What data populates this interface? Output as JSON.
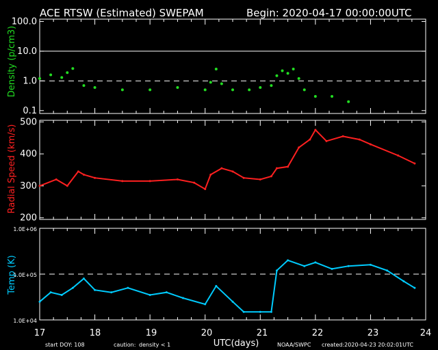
{
  "header": {
    "title": "ACE RTSW (Estimated) SWEPAM",
    "begin": "Begin: 2020-04-17 00:00:00UTC"
  },
  "footer": {
    "start_doy": "start DOY: 108",
    "caution_label": "caution:",
    "caution_value": "density < 1",
    "source": "NOAA/SWPC",
    "created": "created:2020-04-23 20:02:01UTC"
  },
  "colors": {
    "density": "#22dd22",
    "speed": "#ff2020",
    "temp": "#00ccff",
    "caution": "#ffff00",
    "axes": "#ffffff"
  },
  "chart_data": [
    {
      "type": "scatter",
      "panel": "density",
      "ylabel": "Density (p/cm3)",
      "yscale": "log",
      "ylim": [
        0.08,
        120
      ],
      "xlim": [
        17,
        24
      ],
      "yticks": [
        "0.1",
        "1.0",
        "10.0",
        "100.0"
      ],
      "reference_line": 10,
      "dashed_line": 1,
      "x": [
        17.0,
        17.2,
        17.4,
        17.5,
        17.6,
        17.8,
        18.0,
        18.5,
        19.0,
        19.5,
        20.0,
        20.1,
        20.2,
        20.3,
        20.5,
        20.8,
        21.0,
        21.2,
        21.3,
        21.4,
        21.5,
        21.6,
        21.7,
        21.8,
        22.0,
        22.3,
        22.6
      ],
      "y": [
        1.2,
        1.6,
        1.3,
        1.9,
        2.6,
        0.7,
        0.6,
        0.5,
        0.5,
        0.6,
        0.5,
        0.9,
        2.5,
        0.8,
        0.5,
        0.5,
        0.6,
        0.7,
        1.5,
        2.2,
        1.8,
        2.5,
        1.2,
        0.5,
        0.3,
        0.3,
        0.2
      ]
    },
    {
      "type": "line",
      "panel": "speed",
      "ylabel": "Radial Speed (km/s)",
      "ylim": [
        195,
        505
      ],
      "xlim": [
        17,
        24
      ],
      "yticks": [
        200,
        300,
        400,
        500
      ],
      "x": [
        17.0,
        17.3,
        17.5,
        17.7,
        17.8,
        18.0,
        18.5,
        19.0,
        19.5,
        19.8,
        20.0,
        20.1,
        20.3,
        20.5,
        20.7,
        21.0,
        21.2,
        21.3,
        21.5,
        21.7,
        21.9,
        22.0,
        22.2,
        22.5,
        22.8,
        23.0,
        23.5,
        23.8
      ],
      "y": [
        300,
        320,
        300,
        345,
        335,
        325,
        315,
        315,
        320,
        310,
        290,
        335,
        355,
        345,
        325,
        320,
        330,
        355,
        360,
        420,
        445,
        475,
        440,
        455,
        445,
        430,
        395,
        370
      ]
    },
    {
      "type": "line",
      "panel": "temp",
      "ylabel": "Temp (K)",
      "yscale": "log",
      "ylim": [
        10000,
        1000000
      ],
      "xlim": [
        17,
        24
      ],
      "yticks": [
        "1.0E+04",
        "1.0E+05",
        "1.0E+06"
      ],
      "dashed_line": 100000,
      "xlabel": "UTC(days)",
      "xticks": [
        "17",
        "18",
        "19",
        "20",
        "21",
        "22",
        "23",
        "24"
      ],
      "x": [
        17.0,
        17.2,
        17.4,
        17.6,
        17.8,
        18.0,
        18.3,
        18.6,
        19.0,
        19.3,
        19.6,
        20.0,
        20.2,
        20.5,
        20.7,
        21.0,
        21.2,
        21.3,
        21.5,
        21.8,
        22.0,
        22.3,
        22.6,
        23.0,
        23.3,
        23.6,
        23.8
      ],
      "y": [
        25000,
        40000,
        35000,
        50000,
        80000,
        45000,
        40000,
        50000,
        35000,
        40000,
        30000,
        22000,
        55000,
        25000,
        15000,
        15000,
        15000,
        120000,
        200000,
        150000,
        180000,
        130000,
        150000,
        160000,
        120000,
        70000,
        50000
      ]
    }
  ]
}
